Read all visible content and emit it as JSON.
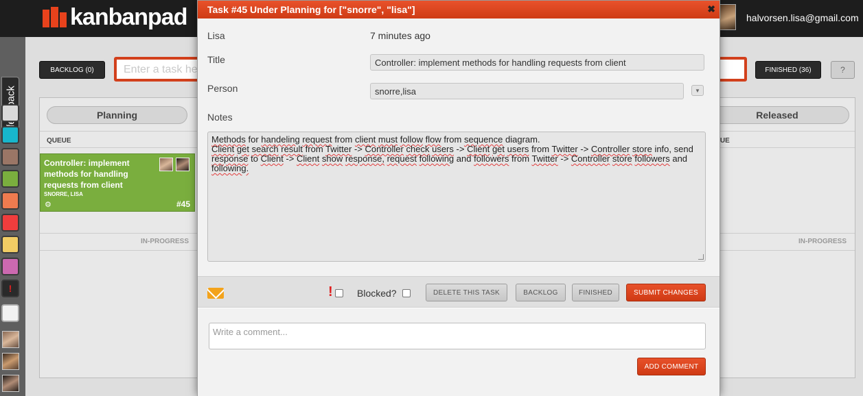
{
  "header": {
    "logo_text": "kanbanpad",
    "user_email": "halvorsen.lisa@gmail.com"
  },
  "sidebar": {
    "feedback_label": "feedback",
    "swatches": [
      {
        "name": "swatch-silver",
        "color": "#d9d9d9"
      },
      {
        "name": "swatch-cyan",
        "color": "#18b6cc"
      },
      {
        "name": "swatch-brown",
        "color": "#9a7666"
      },
      {
        "name": "swatch-green",
        "color": "#7aae3e"
      },
      {
        "name": "swatch-salmon",
        "color": "#ee7b4f"
      },
      {
        "name": "swatch-red",
        "color": "#ef3d3d"
      },
      {
        "name": "swatch-yellow",
        "color": "#f1cc64"
      },
      {
        "name": "swatch-pink",
        "color": "#cc69b0"
      },
      {
        "name": "swatch-urgent",
        "color": "#2a2a2a"
      }
    ],
    "urgent_icon": "!"
  },
  "board": {
    "backlog_label": "BACKLOG (0)",
    "task_input_placeholder": "Enter a task he",
    "finished_label": "FINISHED (36)",
    "help_label": "?",
    "columns": [
      {
        "title": "Planning",
        "queue_label": "QUEUE",
        "inprogress_label": "IN-PROGRESS"
      },
      {
        "title": "Released",
        "queue_label": "UEUE",
        "inprogress_label": "IN-PROGRESS"
      }
    ],
    "card": {
      "title": "Controller: implement methods for handling requests from client",
      "people": "SNORRE, LISA",
      "number": "#45",
      "color": "#7aae3e"
    }
  },
  "modal": {
    "title": "Task #45 Under Planning for [\"snorre\", \"lisa\"]",
    "close_icon": "✖",
    "author": "Lisa",
    "time_ago": "7 minutes ago",
    "title_label": "Title",
    "title_value": "Controller: implement methods for handling requests from client",
    "person_label": "Person",
    "person_value": "snorre,lisa",
    "notes_label": "Notes",
    "notes_text": "Methods for handeling request from client must follow flow from sequence diagram.\nClient get search result from Twitter -> Controller check users -> Client get users from Twitter -> Controller store info, send response to Client -> Client show response, request following and followers from Twitter -> Controller store followers and following.",
    "urgent_mark": "!",
    "blocked_label": "Blocked?",
    "delete_label": "DELETE THIS TASK",
    "backlog_label": "BACKLOG",
    "finished_label": "FINISHED",
    "submit_label": "SUBMIT CHANGES",
    "comment_placeholder": "Write a comment...",
    "add_comment_label": "ADD COMMENT"
  }
}
